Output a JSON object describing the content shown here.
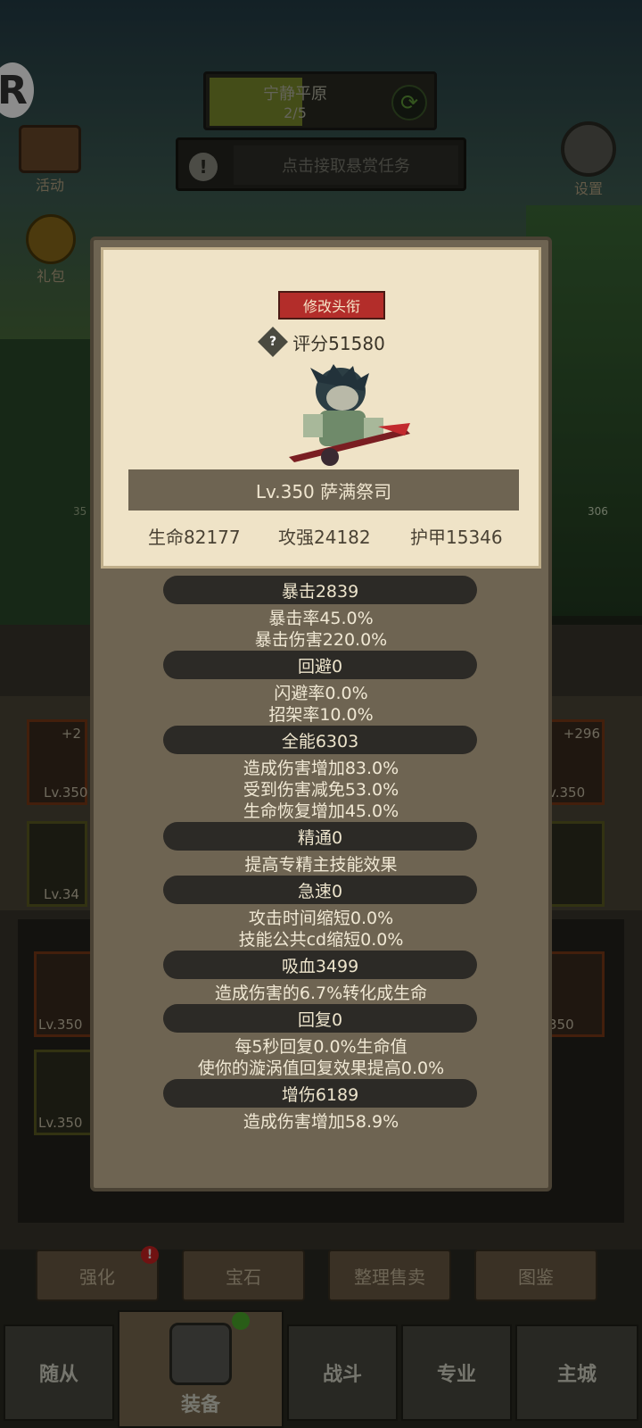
{
  "hud": {
    "stage_name": "宁静平原",
    "stage_progress": "2/5",
    "bounty_text": "点击接取悬赏任务",
    "activity_label": "活动",
    "gift_label": "礼包",
    "settings_label": "设置"
  },
  "dialog": {
    "edit_title_button": "修改头衔",
    "score": "评分51580",
    "hero_name": "Lv.350 萨满祭司",
    "hp": "生命82177",
    "attack": "攻强24182",
    "armor": "护甲15346"
  },
  "attributes": [
    {
      "head": "暴击2839",
      "subs": [
        "暴击率45.0%",
        "暴击伤害220.0%"
      ]
    },
    {
      "head": "回避0",
      "subs": [
        "闪避率0.0%",
        "招架率10.0%"
      ]
    },
    {
      "head": "全能6303",
      "subs": [
        "造成伤害增加83.0%",
        "受到伤害减免53.0%",
        "生命恢复增加45.0%"
      ]
    },
    {
      "head": "精通0",
      "subs": [
        "提高专精主技能效果"
      ]
    },
    {
      "head": "急速0",
      "subs": [
        "攻击时间缩短0.0%",
        "技能公共cd缩短0.0%"
      ]
    },
    {
      "head": "吸血3499",
      "subs": [
        "造成伤害的6.7%转化成生命"
      ]
    },
    {
      "head": "回复0",
      "subs": [
        "每5秒回复0.0%生命值",
        "使你的漩涡值回复效果提高0.0%"
      ]
    },
    {
      "head": "增伤6189",
      "subs": [
        "造成伤害增加58.9%"
      ]
    }
  ],
  "background_slots": {
    "left_top_plus": "+2",
    "left_top_level": "Lv.350",
    "left_mid_level": "Lv.34",
    "right_top_plus": "+296",
    "right_top_level": "v.350",
    "left_low1_level": "Lv.350",
    "left_low2_level": "Lv.350",
    "right_low_level": "350",
    "side_num_left": "35",
    "side_num_right": "306"
  },
  "bottom_buttons": [
    "强化",
    "宝石",
    "整理售卖",
    "图鉴"
  ],
  "tabs": [
    "随从",
    "装备",
    "战斗",
    "专业",
    "主城"
  ],
  "colors": {
    "title_button": "#b32d2a",
    "dialog_parchment": "#efe3c7",
    "dialog_body": "#6e6452",
    "attr_head_bg": "#2c2a26"
  }
}
